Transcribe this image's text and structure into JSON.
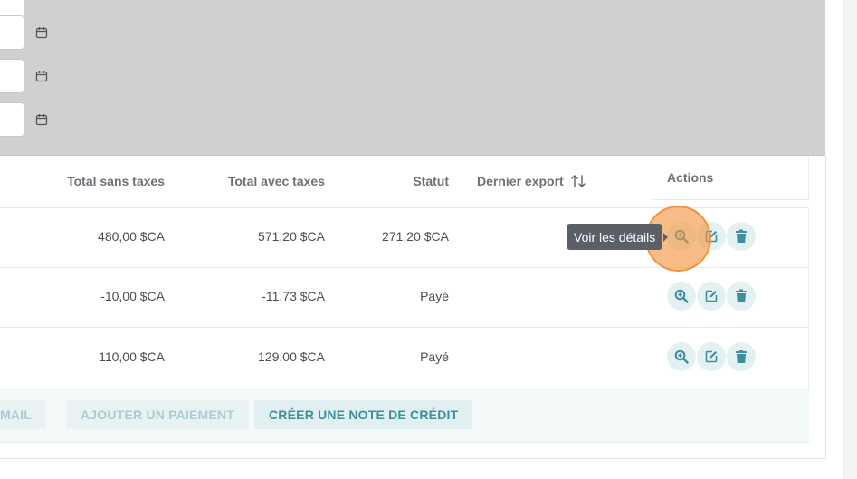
{
  "table": {
    "headers": {
      "total_ht": "Total sans taxes",
      "total_ttc": "Total avec taxes",
      "status": "Statut",
      "last_export": "Dernier export",
      "actions": "Actions"
    },
    "rows": [
      {
        "total_ht": "480,00 $CA",
        "total_ttc": "571,20 $CA",
        "status": "271,20 $CA",
        "last_export": ""
      },
      {
        "total_ht": "-10,00 $CA",
        "total_ttc": "-11,73 $CA",
        "status": "Payé",
        "last_export": ""
      },
      {
        "total_ht": "110,00 $CA",
        "total_ttc": "129,00 $CA",
        "status": "Payé",
        "last_export": ""
      }
    ]
  },
  "footer": {
    "send_mail": "MAIL",
    "add_payment": "AJOUTER UN PAIEMENT",
    "credit_note": "CRÉER UNE NOTE DE CRÉDIT"
  },
  "tooltip": {
    "text": "Voir les détails"
  },
  "icons": {
    "calendar": "calendar-icon",
    "sort": "sort-arrows-icon",
    "view": "zoom-in-icon",
    "edit": "edit-icon",
    "delete": "trash-icon"
  },
  "colors": {
    "accent": "#3d8fa0",
    "action_bg": "#e3f1f3",
    "overlay": "#d0d0d0",
    "highlight": "#f4943c"
  }
}
